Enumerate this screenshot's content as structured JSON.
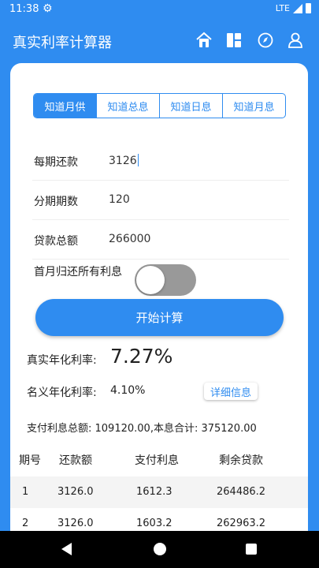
{
  "status": {
    "time": "11:38",
    "network": "LTE"
  },
  "app": {
    "title": "真实利率计算器"
  },
  "tabs": [
    {
      "label": "知道月供",
      "active": true
    },
    {
      "label": "知道总息",
      "active": false
    },
    {
      "label": "知道日息",
      "active": false
    },
    {
      "label": "知道月息",
      "active": false
    }
  ],
  "form": {
    "payment": {
      "label": "每期还款",
      "value": "3126"
    },
    "periods": {
      "label": "分期期数",
      "value": "120"
    },
    "total": {
      "label": "贷款总额",
      "value": "266000"
    },
    "first_month_interest": {
      "label": "首月归还所有利息",
      "checked": false
    }
  },
  "calc_button": "开始计算",
  "results": {
    "real_rate_label": "真实年化利率:",
    "real_rate_value": "7.27%",
    "nominal_rate_label": "名义年化利率:",
    "nominal_rate_value": "4.10%",
    "detail_button": "详细信息",
    "summary": "支付利息总额:  109120.00,本息合计: 375120.00"
  },
  "table": {
    "headers": [
      "期号",
      "还款额",
      "支付利息",
      "剩余贷款"
    ],
    "rows": [
      [
        "1",
        "3126.0",
        "1612.3",
        "264486.2"
      ],
      [
        "2",
        "3126.0",
        "1603.2",
        "262963.2"
      ]
    ]
  }
}
